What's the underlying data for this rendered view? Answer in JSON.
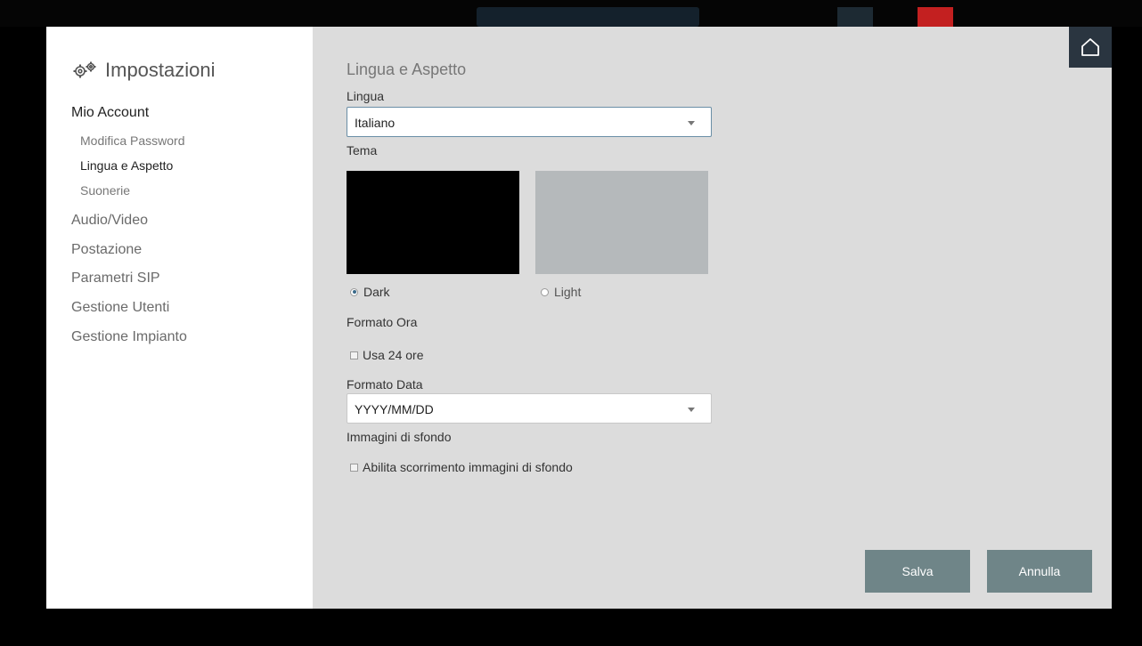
{
  "sidebar": {
    "title": "Impostazioni",
    "icon": "gear-icon",
    "items": [
      {
        "label": "Mio Account"
      },
      {
        "label": "Modifica Password"
      },
      {
        "label": "Lingua e Aspetto"
      },
      {
        "label": "Suonerie"
      },
      {
        "label": "Audio/Video"
      },
      {
        "label": "Postazione"
      },
      {
        "label": "Parametri SIP"
      },
      {
        "label": "Gestione Utenti"
      },
      {
        "label": "Gestione Impianto"
      }
    ]
  },
  "content": {
    "section_title": "Lingua e Aspetto",
    "language": {
      "label": "Lingua",
      "value": "Italiano"
    },
    "theme": {
      "label": "Tema",
      "dark_label": "Dark",
      "light_label": "Light",
      "selected": "Dark",
      "dark_color": "#000000",
      "light_color": "#b5b9bb"
    },
    "time_format": {
      "label": "Formato Ora",
      "checkbox_label": "Usa 24 ore",
      "checked": false
    },
    "date_format": {
      "label": "Formato Data",
      "value": "YYYY/MM/DD"
    },
    "wallpaper": {
      "label": "Immagini di sfondo",
      "checkbox_label": "Abilita scorrimento immagini di sfondo",
      "checked": false
    }
  },
  "buttons": {
    "save_label": "Salva",
    "cancel_label": "Annulla",
    "color": "#6f8588"
  },
  "home_icon": "home-icon"
}
